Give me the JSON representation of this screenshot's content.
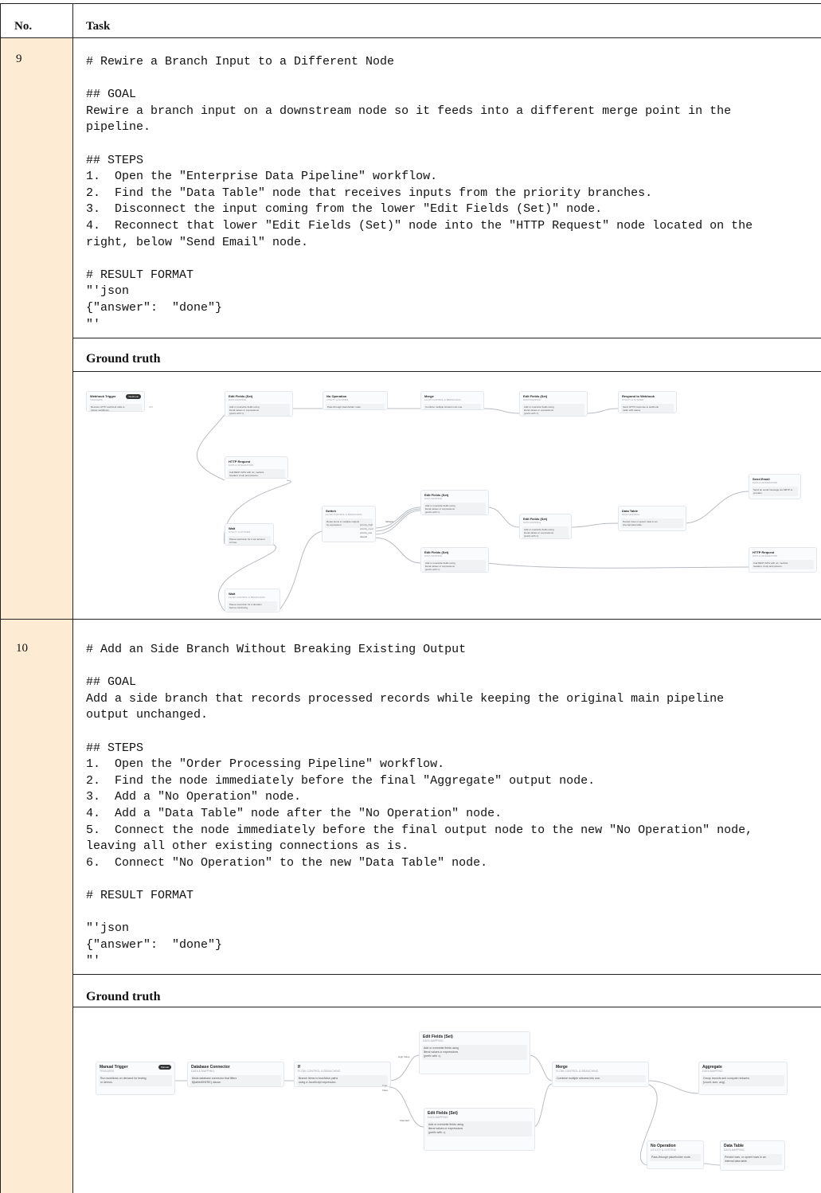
{
  "table": {
    "col_no": "No.",
    "col_task": "Task"
  },
  "rows": [
    {
      "no": "9",
      "task_text": "# Rewire a Branch Input to a Different Node\n\n## GOAL\nRewire a branch input on a downstream node so it feeds into a different merge point in the\npipeline.\n\n## STEPS\n1.  Open the \"Enterprise Data Pipeline\" workflow.\n2.  Find the \"Data Table\" node that receives inputs from the priority branches.\n3.  Disconnect the input coming from the lower \"Edit Fields (Set)\" node.\n4.  Reconnect that lower \"Edit Fields (Set)\" node into the \"HTTP Request\" node located on the\nright, below \"Send Email\" node.\n\n# RESULT FORMAT\n\"'json\n{\"answer\":  \"done\"}\n\"'",
      "gt_label": "Ground truth",
      "nodes": [
        {
          "title": "Webhook Trigger",
          "sub": "TRIGGERS",
          "desc": "Receive HTTP webhook calls to\ntrigger workflows.",
          "badge": "Webhook"
        },
        {
          "title": "Edit Fields (Set)",
          "sub": "DATA MAPPING",
          "desc": "Add or overwrite fields using\nliteral values or expressions\n(prefix with =)."
        },
        {
          "title": "No Operation",
          "sub": "UTILITY & SYSTEM",
          "desc": "Pass-through placeholder node."
        },
        {
          "title": "Merge",
          "sub": "FLOW CONTROL & BRANCHING",
          "desc": "Combine multiple streams into one."
        },
        {
          "title": "Edit Fields (Set)",
          "sub": "DATA MAPPING",
          "desc": "Add or overwrite fields using\nliteral values or expressions\n(prefix with =)."
        },
        {
          "title": "Respond to Webhook",
          "sub": "UTILITY & SYSTEM",
          "desc": "Send HTTP response to webhook\ncaller with status."
        },
        {
          "title": "HTTP Request",
          "sub": "DATA & INTEGRATION",
          "desc": "Call REST APIs with url, method,\nheaders, body and params."
        },
        {
          "title": "Wait",
          "sub": "UTILITY & SYSTEM",
          "desc": "Pause execution for a set amount\nof time."
        },
        {
          "title": "Wait",
          "sub": "FLOW CONTROL & BRANCHING",
          "desc": "Pause execution for a duration\nbefore continuing."
        },
        {
          "title": "Switch",
          "sub": "FLOW CONTROL & BRANCHING",
          "desc": "Route items to multiple outputs\nby expression."
        },
        {
          "title": "Edit Fields (Set)",
          "sub": "DATA MAPPING",
          "desc": "Add or overwrite fields using\nliteral values or expressions\n(prefix with =)."
        },
        {
          "title": "Edit Fields (Set)",
          "sub": "DATA MAPPING",
          "desc": "Add or overwrite fields using\nliteral values or expressions\n(prefix with =)."
        },
        {
          "title": "Data Table",
          "sub": "DATA MAPPING",
          "desc": "Persist rows or upsert rows in an\ninternal data table."
        },
        {
          "title": "Edit Fields (Set)",
          "sub": "DATA MAPPING",
          "desc": "Add or overwrite fields using\nliteral values or expressions\n(prefix with =)."
        },
        {
          "title": "Send Email",
          "sub": "DATA & INTEGRATION",
          "desc": "Send an email message via SMTP or\nprovider."
        },
        {
          "title": "HTTP Request",
          "sub": "DATA & INTEGRATION",
          "desc": "Call REST APIs with url, method,\nheaders, body and params."
        }
      ],
      "edge_labels": [
        "priority_high",
        "priority_med",
        "priority_low",
        "default",
        "fallback"
      ]
    },
    {
      "no": "10",
      "task_text": "# Add an Side Branch Without Breaking Existing Output\n\n## GOAL\nAdd a side branch that records processed records while keeping the original main pipeline\noutput unchanged.\n\n## STEPS\n1.  Open the \"Order Processing Pipeline\" workflow.\n2.  Find the node immediately before the final \"Aggregate\" output node.\n3.  Add a \"No Operation\" node.\n4.  Add a \"Data Table\" node after the \"No Operation\" node.\n5.  Connect the node immediately before the final output node to the new \"No Operation\" node,\nleaving all other existing connections as is.\n6.  Connect \"No Operation\" to the new \"Data Table\" node.\n\n# RESULT FORMAT\n\n\"'json\n{\"answer\":  \"done\"}\n\"'",
      "gt_label": "Ground truth",
      "nodes": [
        {
          "title": "Manual Trigger",
          "sub": "TRIGGERS",
          "desc": "Run workflows on demand for testing\nor demos.",
          "badge": "Manual"
        },
        {
          "title": "Database Connector",
          "sub": "DATA & MAPPING",
          "desc": "Mock database connector that filters\n${tableWHERE} clause."
        },
        {
          "title": "If",
          "sub": "FLOW CONTROL & BRANCHING",
          "desc": "Branch items to true/false paths\nusing a JavaScript expression."
        },
        {
          "title": "Edit Fields (Set)",
          "sub": "DATA MAPPING",
          "desc": "Add or overwrite fields using\nliteral values or expressions\n(prefix with =)."
        },
        {
          "title": "Edit Fields (Set)",
          "sub": "DATA MAPPING",
          "desc": "Add or overwrite fields using\nliteral values or expressions\n(prefix with =)."
        },
        {
          "title": "Merge",
          "sub": "FLOW CONTROL & BRANCHING",
          "desc": "Combine multiple streams into one."
        },
        {
          "title": "Aggregate",
          "sub": "DATA MAPPING",
          "desc": "Group records and compute reducers\n(count, sum, avg)."
        },
        {
          "title": "No Operation",
          "sub": "UTILITY & SYSTEM",
          "desc": "Pass-through placeholder node."
        },
        {
          "title": "Data Table",
          "sub": "DATA MAPPING",
          "desc": "Persist rows, or upsert rows in an\ninternal data table."
        }
      ],
      "edge_labels": [
        "True",
        "False",
        "High Value",
        "Standard"
      ]
    }
  ]
}
